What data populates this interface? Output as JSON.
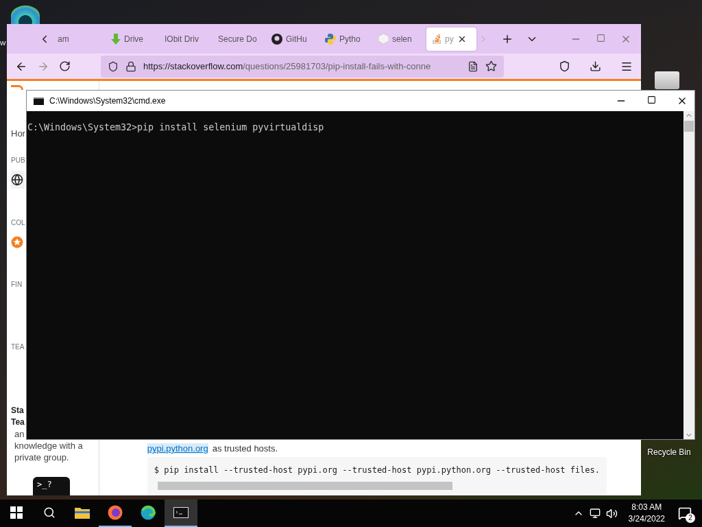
{
  "desktop": {
    "edge_text": "W",
    "icons": [
      {
        "label": "Recycle Bin"
      }
    ]
  },
  "browser": {
    "tabs": [
      {
        "label": "am",
        "kind": "plain",
        "selected": false
      },
      {
        "label": "Drive",
        "kind": "download",
        "selected": false
      },
      {
        "label": "IObit Driv",
        "kind": "plain",
        "selected": false
      },
      {
        "label": "Secure Do",
        "kind": "plain",
        "selected": false
      },
      {
        "label": "GitHu",
        "kind": "github",
        "selected": false
      },
      {
        "label": "Pytho",
        "kind": "python",
        "selected": false
      },
      {
        "label": "selen",
        "kind": "cube",
        "selected": false
      },
      {
        "label": "py",
        "kind": "stack",
        "selected": true
      }
    ],
    "url": {
      "host": "https://stackoverflow.com",
      "path": "/questions/25981703/pip-install-fails-with-conne"
    },
    "sidebar": {
      "home": "Hor",
      "sections": [
        {
          "heading": "PUB",
          "kind": "globe"
        },
        {
          "heading": "COL",
          "kind": "star"
        },
        {
          "heading": "FIN",
          "kind": "none"
        },
        {
          "heading": "TEA",
          "kind": "none"
        }
      ],
      "teams_title": [
        "Sta",
        "Tea"
      ],
      "teams_text": [
        "an",
        "knowledge with a",
        "private group."
      ],
      "badge_text": ">_?"
    },
    "content": {
      "link": "pypi.python.org",
      "after_link": "as trusted hosts.",
      "code": "$ pip install --trusted-host pypi.org --trusted-host pypi.python.org --trusted-host files."
    }
  },
  "console_window": {
    "title": "C:\\Windows\\System32\\cmd.exe",
    "lines": [
      "C:\\Windows\\System32>pip install selenium pyvirtualdisp"
    ]
  },
  "taskbar": {
    "apps": [
      {
        "kind": "folder",
        "running": false,
        "selected": false
      },
      {
        "kind": "firefox",
        "running": true,
        "selected": false
      },
      {
        "kind": "edge",
        "running": false,
        "selected": false
      },
      {
        "kind": "console",
        "running": true,
        "selected": true
      }
    ],
    "time": "8:03 AM",
    "date": "3/24/2022",
    "notification_count": "2"
  }
}
